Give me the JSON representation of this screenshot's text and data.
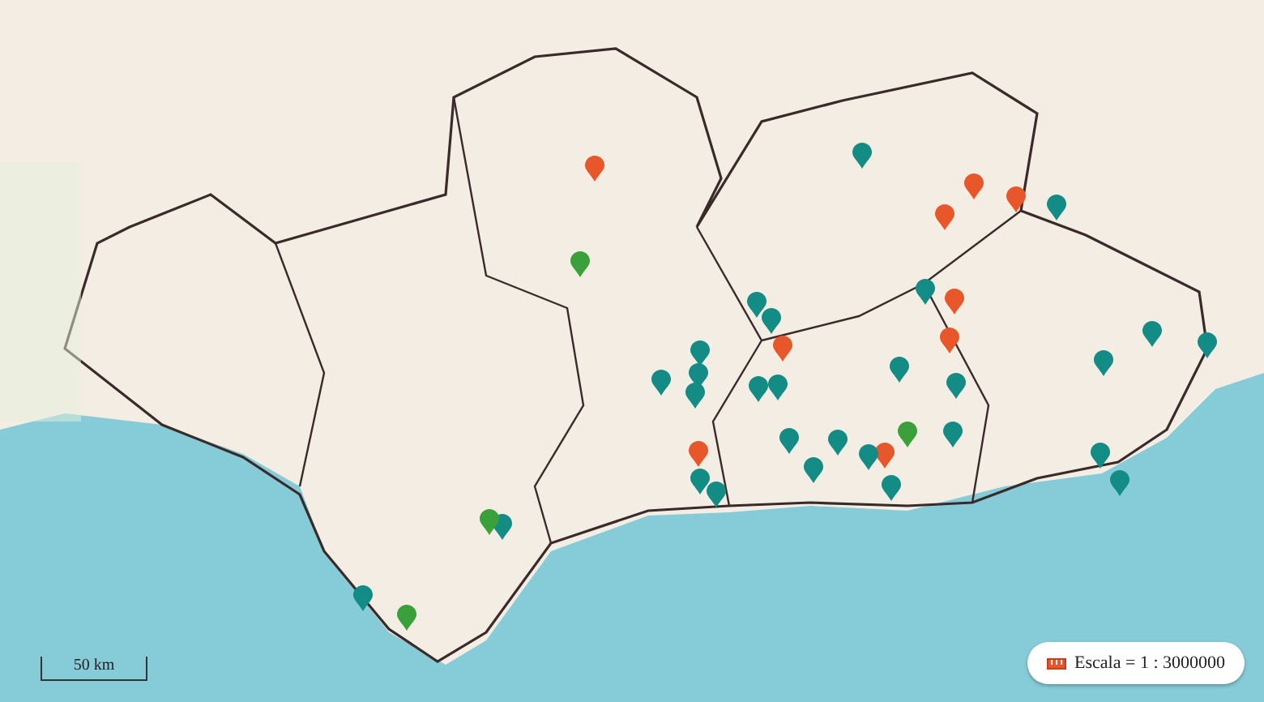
{
  "map": {
    "pins": [
      {
        "color": "#e8572a"
      },
      {
        "color": "#e8572a"
      },
      {
        "color": "#e8572a"
      },
      {
        "color": "#e8572a"
      },
      {
        "color": "#e8572a"
      },
      {
        "color": "#e8572a"
      },
      {
        "color": "#e8572a"
      },
      {
        "color": "#e8572a"
      },
      {
        "color": "#e8572a"
      },
      {
        "color": "#138c86"
      },
      {
        "color": "#138c86"
      },
      {
        "color": "#138c86"
      },
      {
        "color": "#138c86"
      },
      {
        "color": "#138c86"
      },
      {
        "color": "#138c86"
      },
      {
        "color": "#138c86"
      },
      {
        "color": "#138c86"
      },
      {
        "color": "#138c86"
      },
      {
        "color": "#138c86"
      },
      {
        "color": "#138c86"
      },
      {
        "color": "#138c86"
      },
      {
        "color": "#138c86"
      },
      {
        "color": "#138c86"
      },
      {
        "color": "#138c86"
      },
      {
        "color": "#138c86"
      },
      {
        "color": "#138c86"
      },
      {
        "color": "#138c86"
      },
      {
        "color": "#138c86"
      },
      {
        "color": "#138c86"
      },
      {
        "color": "#138c86"
      },
      {
        "color": "#138c86"
      },
      {
        "color": "#138c86"
      },
      {
        "color": "#138c86"
      },
      {
        "color": "#138c86"
      },
      {
        "color": "#138c86"
      },
      {
        "color": "#138c86"
      },
      {
        "color": "#138c86"
      },
      {
        "color": "#3aa03a"
      },
      {
        "color": "#3aa03a"
      },
      {
        "color": "#3aa03a"
      },
      {
        "color": "#3aa03a"
      }
    ],
    "scale_bar": {
      "label": "50 km"
    },
    "scale_badge": {
      "label": "Escala = 1 : 3000000"
    }
  }
}
